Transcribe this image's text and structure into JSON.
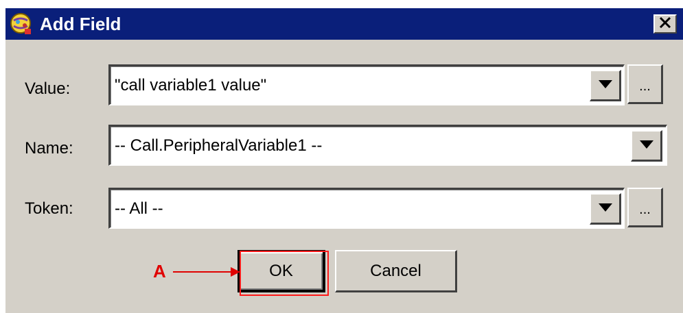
{
  "window": {
    "title": "Add Field",
    "app_icon": "app-globe-icon",
    "close_icon": "close-x-icon"
  },
  "form": {
    "value": {
      "label": "Value:",
      "text": "\"call variable1 value\"",
      "has_browse": true,
      "browse_label": "..."
    },
    "name": {
      "label": "Name:",
      "text": "-- Call.PeripheralVariable1 --"
    },
    "token": {
      "label": "Token:",
      "text": "-- All --",
      "has_browse": true,
      "browse_label": "..."
    }
  },
  "buttons": {
    "ok_label": "OK",
    "cancel_label": "Cancel"
  },
  "annotation": {
    "label": "A",
    "color": "#e00000"
  },
  "colors": {
    "titlebar": "#0a1f7a",
    "dialog_bg": "#d4d0c8"
  }
}
